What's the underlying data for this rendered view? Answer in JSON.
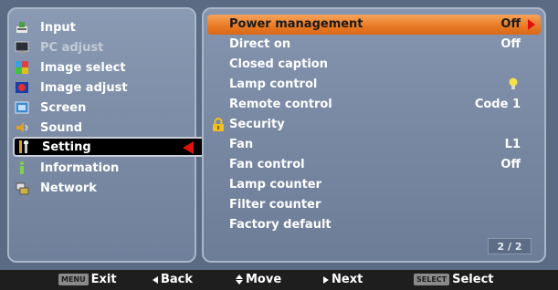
{
  "left_menu": {
    "items": [
      {
        "label": "Input",
        "icon": "input-icon",
        "state": "normal"
      },
      {
        "label": "PC adjust",
        "icon": "pc-adjust-icon",
        "state": "disabled"
      },
      {
        "label": "Image select",
        "icon": "image-select-icon",
        "state": "normal"
      },
      {
        "label": "Image adjust",
        "icon": "image-adjust-icon",
        "state": "normal"
      },
      {
        "label": "Screen",
        "icon": "screen-icon",
        "state": "normal"
      },
      {
        "label": "Sound",
        "icon": "sound-icon",
        "state": "normal"
      },
      {
        "label": "Setting",
        "icon": "setting-icon",
        "state": "selected"
      },
      {
        "label": "Information",
        "icon": "information-icon",
        "state": "normal"
      },
      {
        "label": "Network",
        "icon": "network-icon",
        "state": "normal"
      }
    ]
  },
  "right_menu": {
    "items": [
      {
        "label": "Power management",
        "value": "Off"
      },
      {
        "label": "Direct on",
        "value": "Off"
      },
      {
        "label": "Closed caption",
        "value": ""
      },
      {
        "label": "Lamp control",
        "value": "",
        "value_icon": "lamp-bulb-icon"
      },
      {
        "label": "Remote control",
        "value": "Code 1"
      },
      {
        "label": "Security",
        "value": "",
        "icon": "lock-icon"
      },
      {
        "label": "Fan",
        "value": "L1"
      },
      {
        "label": "Fan control",
        "value": "Off"
      },
      {
        "label": "Lamp counter",
        "value": ""
      },
      {
        "label": "Filter counter",
        "value": ""
      },
      {
        "label": "Factory default",
        "value": ""
      }
    ],
    "page": "2 / 2"
  },
  "bottom_bar": {
    "exit_key": "MENU",
    "exit": "Exit",
    "back": "Back",
    "move": "Move",
    "next": "Next",
    "select_key": "SELECT",
    "select": "Select"
  },
  "colors": {
    "panel": "#7a8aa4",
    "highlight": "#e87822",
    "pointer": "#e01010",
    "bottom_bar": "#1e1e1e"
  }
}
